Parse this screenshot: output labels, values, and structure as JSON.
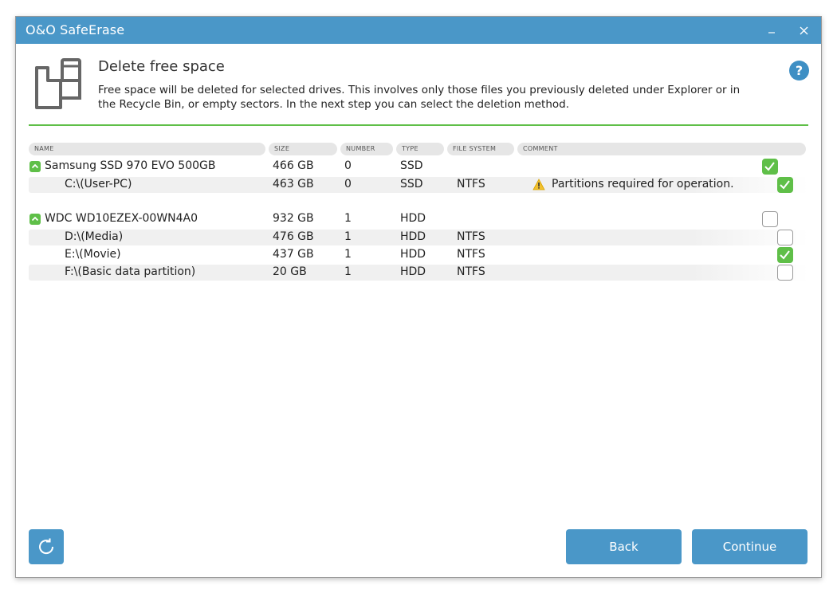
{
  "window": {
    "title": "O&O SafeErase"
  },
  "header": {
    "title": "Delete free space",
    "description": "Free space will be deleted for selected drives. This involves only those files you previously deleted under Explorer or in the Recycle Bin, or empty sectors. In the next step you can select the deletion method.",
    "help": "?"
  },
  "columns": [
    "NAME",
    "SIZE",
    "NUMBER",
    "TYPE",
    "FILE SYSTEM",
    "COMMENT"
  ],
  "drives": [
    {
      "name": "Samsung SSD 970 EVO 500GB",
      "size": "466 GB",
      "number": "0",
      "type": "SSD",
      "checked": true,
      "partitions": [
        {
          "name": "C:\\(User-PC)",
          "size": "463 GB",
          "number": "0",
          "type": "SSD",
          "fs": "NTFS",
          "comment": "Partitions required for operation.",
          "checked": true
        }
      ]
    },
    {
      "name": "WDC WD10EZEX-00WN4A0",
      "size": "932 GB",
      "number": "1",
      "type": "HDD",
      "checked": false,
      "partitions": [
        {
          "name": "D:\\(Media)",
          "size": "476 GB",
          "number": "1",
          "type": "HDD",
          "fs": "NTFS",
          "comment": "",
          "checked": false
        },
        {
          "name": "E:\\(Movie)",
          "size": "437 GB",
          "number": "1",
          "type": "HDD",
          "fs": "NTFS",
          "comment": "",
          "checked": true
        },
        {
          "name": "F:\\(Basic data partition)",
          "size": "20 GB",
          "number": "1",
          "type": "HDD",
          "fs": "NTFS",
          "comment": "",
          "checked": false
        }
      ]
    }
  ],
  "buttons": {
    "back": "Back",
    "continue": "Continue"
  },
  "colors": {
    "accent": "#4a97c8",
    "green": "#5fbf48",
    "warning": "#f2c12e"
  }
}
